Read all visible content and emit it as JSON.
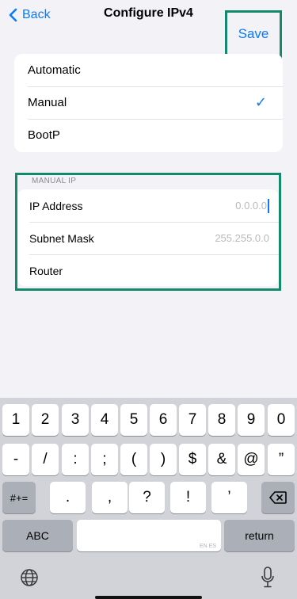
{
  "nav": {
    "back_label": "Back",
    "title": "Configure IPv4",
    "save_label": "Save"
  },
  "modes": [
    {
      "label": "Automatic",
      "selected": false
    },
    {
      "label": "Manual",
      "selected": true
    },
    {
      "label": "BootP",
      "selected": false
    }
  ],
  "checkmark": "✓",
  "manual_ip": {
    "header": "MANUAL IP",
    "fields": [
      {
        "label": "IP Address",
        "placeholder": "0.0.0.0",
        "value": ""
      },
      {
        "label": "Subnet Mask",
        "placeholder": "255.255.0.0",
        "value": ""
      },
      {
        "label": "Router",
        "placeholder": "",
        "value": ""
      }
    ]
  },
  "keyboard": {
    "row1": [
      "1",
      "2",
      "3",
      "4",
      "5",
      "6",
      "7",
      "8",
      "9",
      "0"
    ],
    "row2": [
      "-",
      "/",
      ":",
      ";",
      "(",
      ")",
      "$",
      "&",
      "@",
      "”"
    ],
    "row3_mode": "#+=",
    "row3": [
      ".",
      ",",
      "?",
      "!",
      "’"
    ],
    "abc_label": "ABC",
    "space_hint": "EN ES",
    "return_label": "return"
  },
  "colors": {
    "accent": "#0a7aff",
    "highlight_border": "#138a6b",
    "background": "#f2f2f7"
  }
}
